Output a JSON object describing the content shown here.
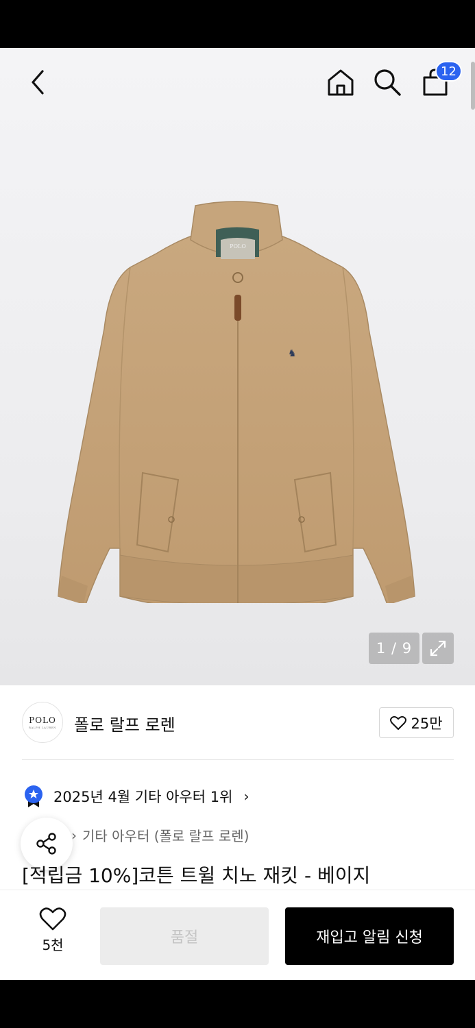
{
  "header": {
    "cart_count": "12"
  },
  "gallery": {
    "counter": "1 / 9"
  },
  "brand": {
    "logo_text": "POLO",
    "logo_subtext": "RALPH LAUREN",
    "name": "폴로 랄프 로렌",
    "likes": "25만"
  },
  "ranking": {
    "text": "2025년 4월 기타 아우터 1위",
    "chevron": "›"
  },
  "breadcrumb": {
    "separator": "›",
    "category": "기타 아우터 (폴로 랄프 로렌)"
  },
  "product": {
    "title": "[적립금 10%]코튼 트윌 치노 재킷 - 베이지"
  },
  "actions": {
    "wish_count": "5천",
    "soldout_label": "품절",
    "restock_label": "재입고 알림 신청"
  },
  "colors": {
    "accent_blue": "#2b63f0",
    "jacket_beige": "#c4a27a"
  }
}
